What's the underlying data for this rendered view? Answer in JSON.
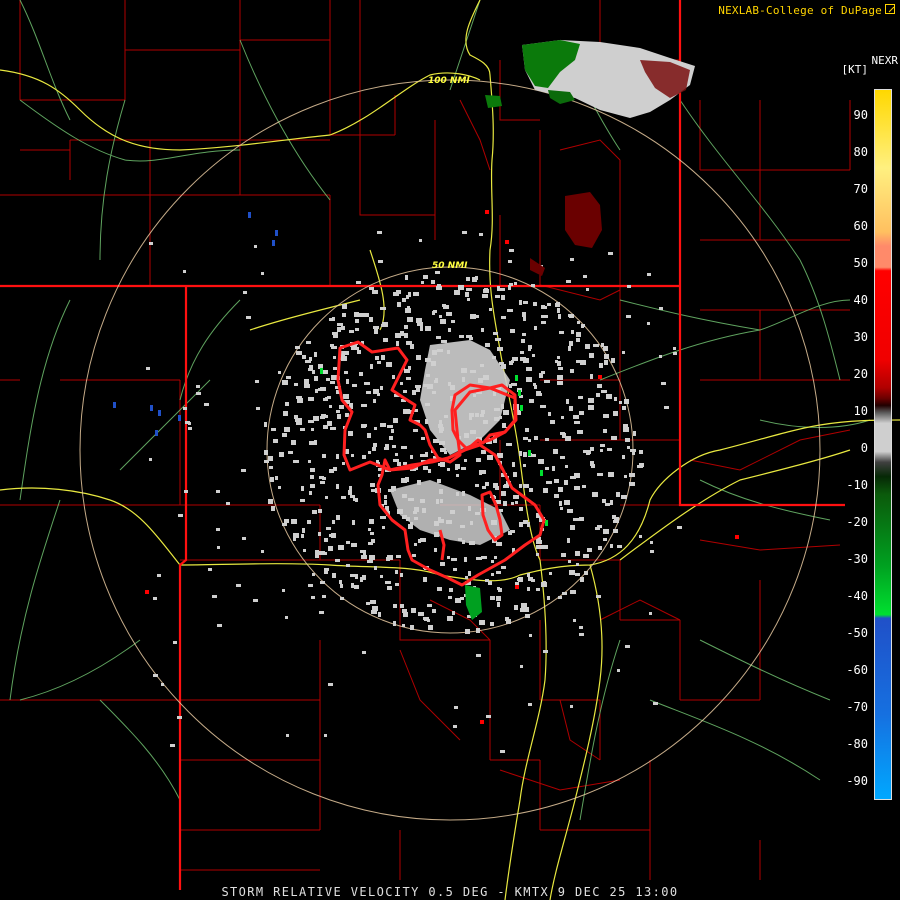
{
  "header": {
    "credit": "NEXLAB-College of DuPage",
    "product": "NEXR",
    "units": "[KT]"
  },
  "footer": {
    "title": "STORM RELATIVE VELOCITY 0.5 DEG - KMTX 9 DEC 25 13:00"
  },
  "range_rings": {
    "inner_label": "50 NMI",
    "outer_label": "100 NMI"
  },
  "legend": {
    "ticks": [
      "90",
      "80",
      "70",
      "60",
      "50",
      "40",
      "30",
      "20",
      "10",
      "0",
      "-10",
      "-20",
      "-30",
      "-40",
      "-50",
      "-60",
      "-70",
      "-80",
      "-90"
    ],
    "colors": {
      "above_70": "#ffd200",
      "band_70": "#ff8a6a",
      "red": "#ff0000",
      "dark_red": "#6a0000",
      "near_zero": "#cfcfcf",
      "dark_green": "#0b5a0b",
      "green": "#00e030",
      "blue": "#2050c8",
      "light_blue": "#00a8ff"
    }
  },
  "map_colors": {
    "county_lines": "#b00000",
    "state_lines": "#ff1010",
    "highways": "#e8e840",
    "roads": "#70c070",
    "rings": "#e8c9a0",
    "warning_polygons": "#ff2020"
  }
}
